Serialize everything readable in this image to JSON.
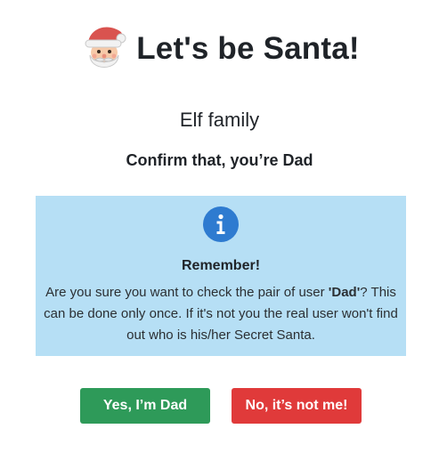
{
  "header": {
    "title": "Let's be Santa!",
    "logo_icon": "santa-face-icon"
  },
  "family_name": "Elf family",
  "confirm_text": "Confirm that, you’re Dad",
  "alert": {
    "icon": "info-icon",
    "heading": "Remember!",
    "body_before": "Are you sure you want to check the pair of user ",
    "quote_open": "'",
    "user_name": "Dad",
    "quote_close": "'",
    "body_after": "? This can be done only once. If it's not you the real user won't find out who is his/her Secret Santa."
  },
  "buttons": {
    "yes_label": "Yes, I’m Dad",
    "no_label": "No, it’s not me!"
  },
  "colors": {
    "alert_background": "#b6dff5",
    "info_icon": "#2e7bd0",
    "yes_button": "#2e9a59",
    "no_button": "#e03a3a"
  }
}
